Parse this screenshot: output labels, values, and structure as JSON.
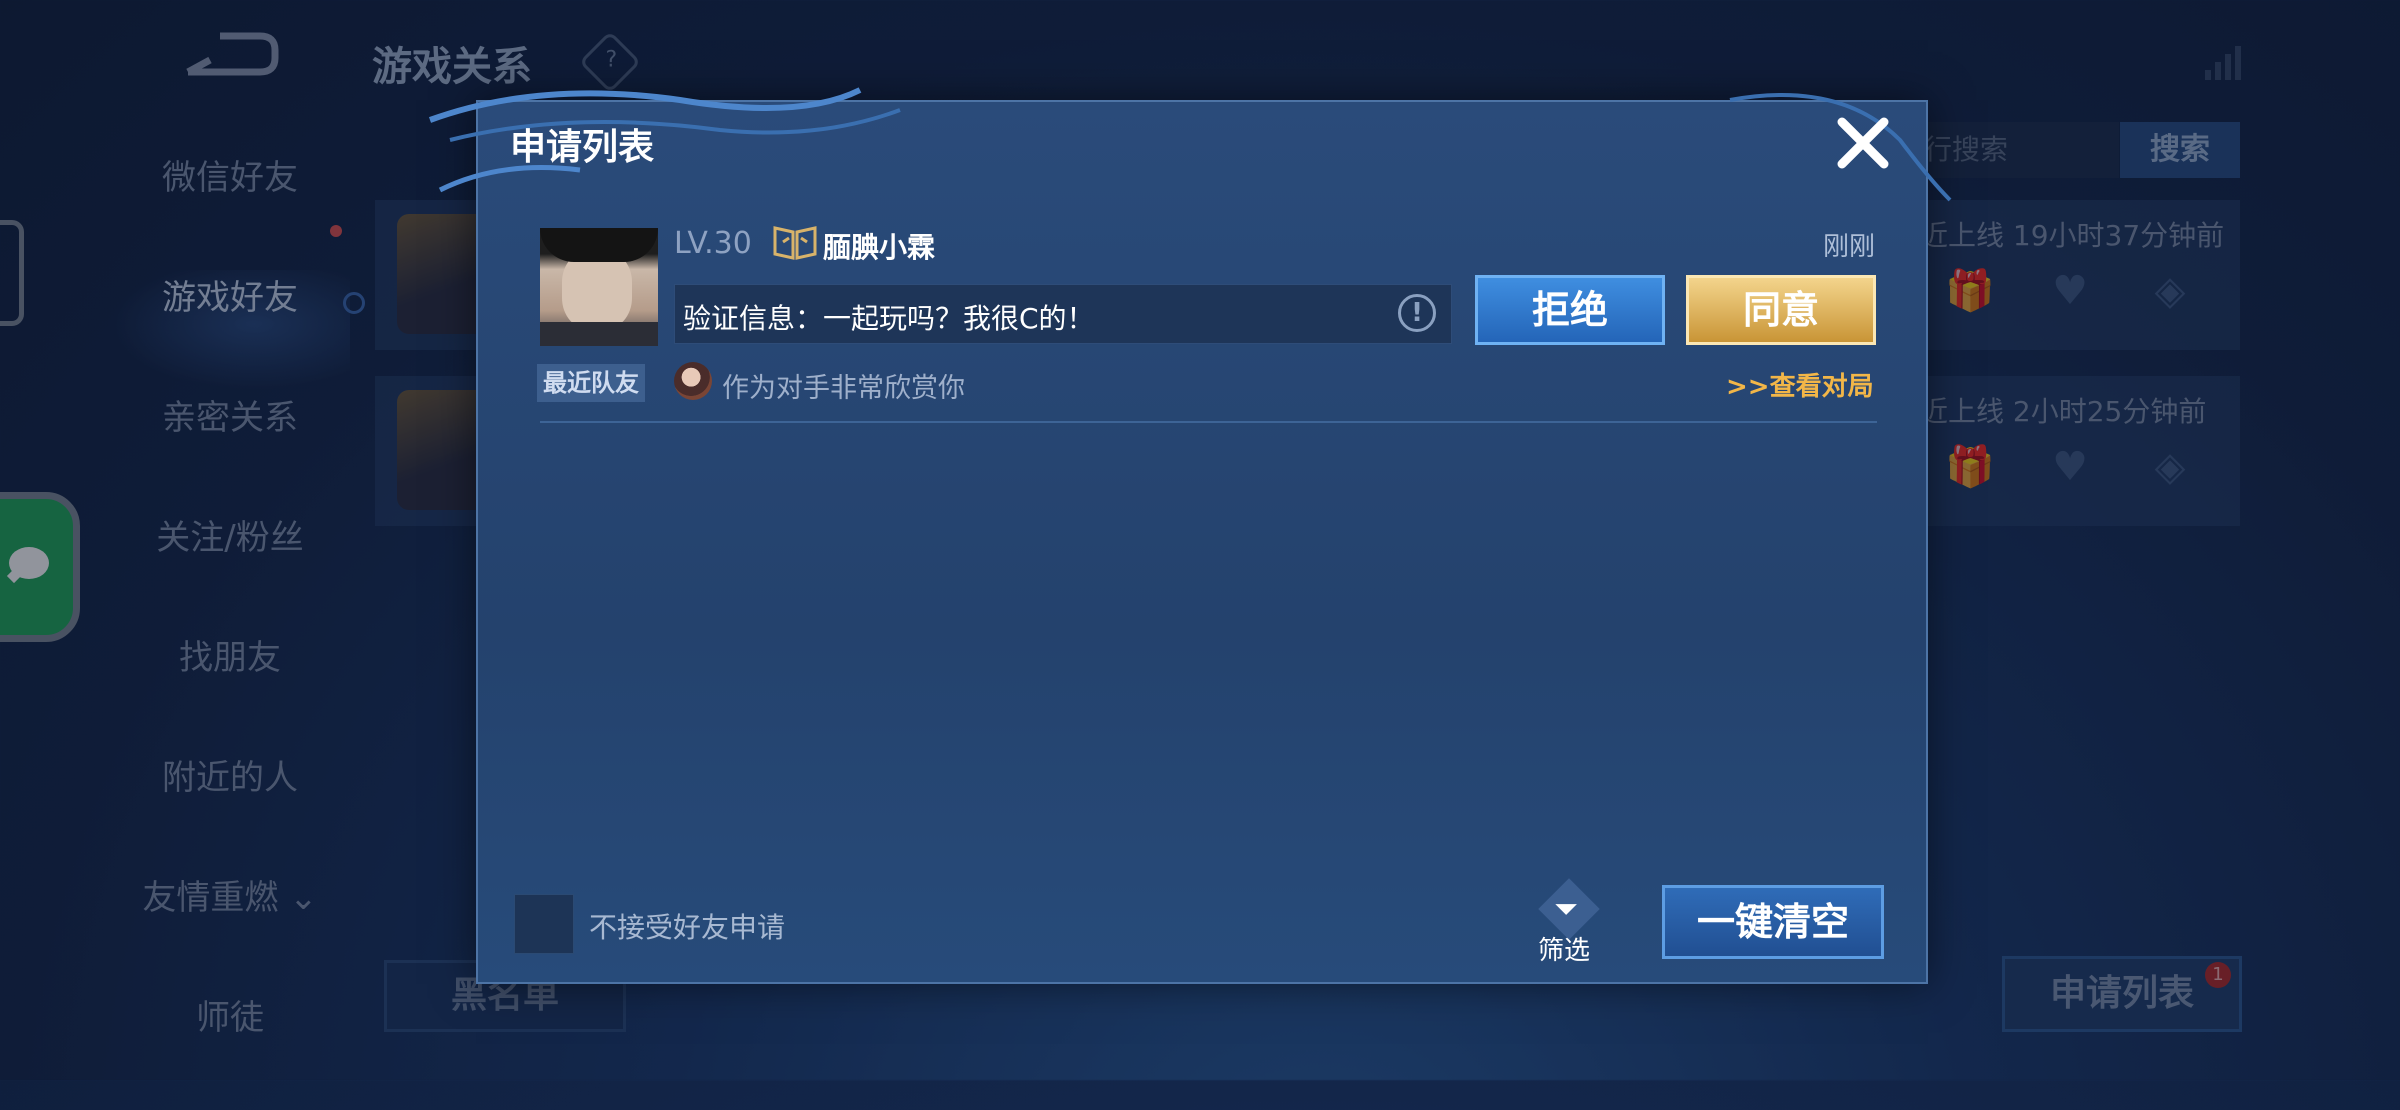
{
  "background": {
    "title": "游戏关系",
    "help_icon": "?",
    "nav": [
      {
        "label": "微信好友"
      },
      {
        "label": "游戏好友",
        "active": true
      },
      {
        "label": "亲密关系"
      },
      {
        "label": "关注/粉丝"
      },
      {
        "label": "找朋友"
      },
      {
        "label": "附近的人"
      },
      {
        "label": "友情重燃 ⌄"
      },
      {
        "label": "师徒"
      }
    ],
    "search_placeholder": "行搜索",
    "search_button": "搜索",
    "friends": [
      {
        "last_online": "近上线  19小时37分钟前"
      },
      {
        "last_online": "近上线  2小时25分钟前"
      }
    ],
    "blacklist_button": "黑名单",
    "apply_list_button": "申请列表",
    "apply_list_badge": "1"
  },
  "dialog": {
    "title": "申请列表",
    "requests": [
      {
        "level": "LV.30",
        "nickname": "腼腆小霖",
        "time": "刚刚",
        "message": "验证信息：一起玩吗？我很C的！",
        "reject_label": "拒绝",
        "accept_label": "同意",
        "tag": "最近队友",
        "note": "作为对手非常欣赏你",
        "view_match": ">>查看对局"
      }
    ],
    "reject_checkbox_label": "不接受好友申请",
    "filter_label": "筛选",
    "clear_all_label": "一键清空"
  },
  "colors": {
    "accent_gold": "#f2b648",
    "reject_blue": "#2f7ad0",
    "accept_gold": "#e0b25c"
  }
}
